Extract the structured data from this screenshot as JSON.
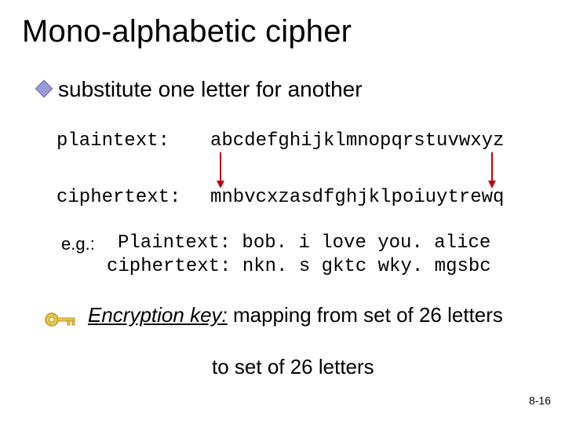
{
  "title": "Mono-alphabetic cipher",
  "bullet": "substitute one letter for another",
  "plaintext_label": "plaintext:",
  "plaintext_value": "abcdefghijklmnopqrstuvwxyz",
  "ciphertext_label": "ciphertext:",
  "ciphertext_value": "mnbvcxzasdfghjklpoiuytrewq",
  "eg_label": "e.g.:",
  "eg_line1": "Plaintext: bob. i love you. alice",
  "eg_line2": "ciphertext: nkn. s gktc wky. mgsbc",
  "key_phrase_lead": "Encryption key:",
  "key_phrase_rest": " mapping from set of 26 letters",
  "key_phrase_line2": "to set of 26 letters",
  "page_number": "8-16"
}
